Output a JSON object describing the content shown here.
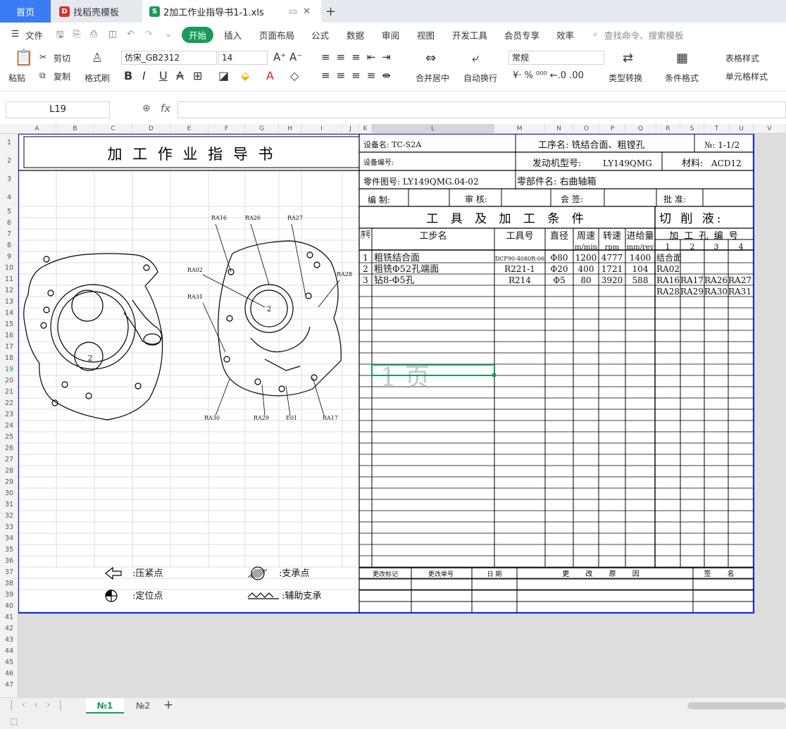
{
  "tabs": {
    "home": "首页",
    "daoke": "找稻壳模板",
    "file": "2加工作业指导书1-1.xls",
    "add": "+"
  },
  "menu": {
    "file": "文件",
    "start": "开始",
    "insert": "插入",
    "layout": "页面布局",
    "formula": "公式",
    "data": "数据",
    "review": "审阅",
    "view": "视图",
    "dev": "开发工具",
    "member": "会员专享",
    "efficiency": "效率",
    "search": "查找命令、搜索模板"
  },
  "ribbon": {
    "paste": "粘贴",
    "cut": "剪切",
    "copy": "复制",
    "format_painter": "格式刷",
    "font_name": "仿宋_GB2312",
    "font_size": "14",
    "merge": "合并居中",
    "wrap": "自动换行",
    "number_format": "常规",
    "type_convert": "类型转换",
    "cond_format": "条件格式",
    "table_style": "表格样式",
    "cell_style": "单元格样式"
  },
  "formula": {
    "name_box": "L19",
    "fx": "fx"
  },
  "sheet": {
    "title": "加 工 作 业 指 导 书",
    "device_name": "设备名: TC-S2A",
    "process_name": "工序名: 铣结合面、粗镗孔",
    "sheet_no": "№: 1-1/2",
    "device_no": "设备编号:",
    "engine_model_label": "发动机型号:",
    "engine_model": "LY149QMG",
    "material_label": "材料:",
    "material": "ACD12",
    "part_drawing": "零件图号: LY149QMG.04-02",
    "part_name": "零部件名: 右曲轴箱",
    "compile": "编 制:",
    "check": "审 核:",
    "countersign": "会 签:",
    "approve": "批 准:",
    "tools_title": "工 具 及 加 工 条 件",
    "coolant": "切 削 液:",
    "hdr_seq": "序号",
    "hdr_step": "工步名",
    "hdr_tool": "工具号",
    "hdr_dia": "直径",
    "hdr_speed": "周速",
    "hdr_speed_u": "m/min",
    "hdr_rpm": "转速",
    "hdr_rpm_u": "rpm",
    "hdr_feed": "进给量",
    "hdr_feed_u": "mm/rev",
    "hdr_holes": "加 工 孔 编 号",
    "hole_cols": [
      "1",
      "2",
      "3",
      "4"
    ],
    "steps": [
      {
        "seq": "1",
        "name": "粗铣结合面",
        "tool": "DCF90-4080R-06",
        "dia": "Φ80",
        "speed": "1200",
        "rpm": "4777",
        "feed": "1400",
        "holes": [
          "结合面",
          "",
          "",
          ""
        ]
      },
      {
        "seq": "2",
        "name": "粗铣Φ52孔端面",
        "tool": "R221-1",
        "dia": "Φ20",
        "speed": "400",
        "rpm": "1721",
        "feed": "104",
        "holes": [
          "RA02",
          "",
          "",
          ""
        ]
      },
      {
        "seq": "3",
        "name": "钻8-Φ5孔",
        "tool": "R214",
        "dia": "Φ5",
        "speed": "80",
        "rpm": "3920",
        "feed": "588",
        "holes": [
          "RA16",
          "RA17",
          "RA26",
          "RA27"
        ]
      },
      {
        "seq": "",
        "name": "",
        "tool": "",
        "dia": "",
        "speed": "",
        "rpm": "",
        "feed": "",
        "holes": [
          "RA28",
          "RA29",
          "RA30",
          "RA31"
        ]
      }
    ],
    "page_watermark": "1 页",
    "change_mark": "更改标记",
    "change_no": "更改单号",
    "date": "日 期",
    "change_reason": "更 改 原 因",
    "sign": "签 名",
    "legend": {
      "press": ":压紧点",
      "support": ":支承点",
      "locate": ":定位点",
      "aux": ":辅助支承"
    },
    "labels": {
      "ra16": "RA16",
      "ra26": "RA26",
      "ra27": "RA27",
      "ra02": "RA02",
      "ra28": "RA28",
      "ra31": "RA31",
      "ra30": "RA30",
      "ra29": "RA29",
      "e01": "E01",
      "ra17": "RA17",
      "two_a": "2",
      "two_b": "2"
    }
  },
  "sheets": {
    "s1": "№1",
    "s2": "№2"
  },
  "columns": [
    "A",
    "B",
    "C",
    "D",
    "E",
    "F",
    "G",
    "H",
    "I",
    "J",
    "K",
    "L",
    "M",
    "N",
    "O",
    "P",
    "Q",
    "R",
    "S",
    "T",
    "U",
    "V"
  ],
  "colors": {
    "accent": "#1a9a5a",
    "brand_blue": "#3b7cf5",
    "border_blue": "#1b2bd0"
  }
}
